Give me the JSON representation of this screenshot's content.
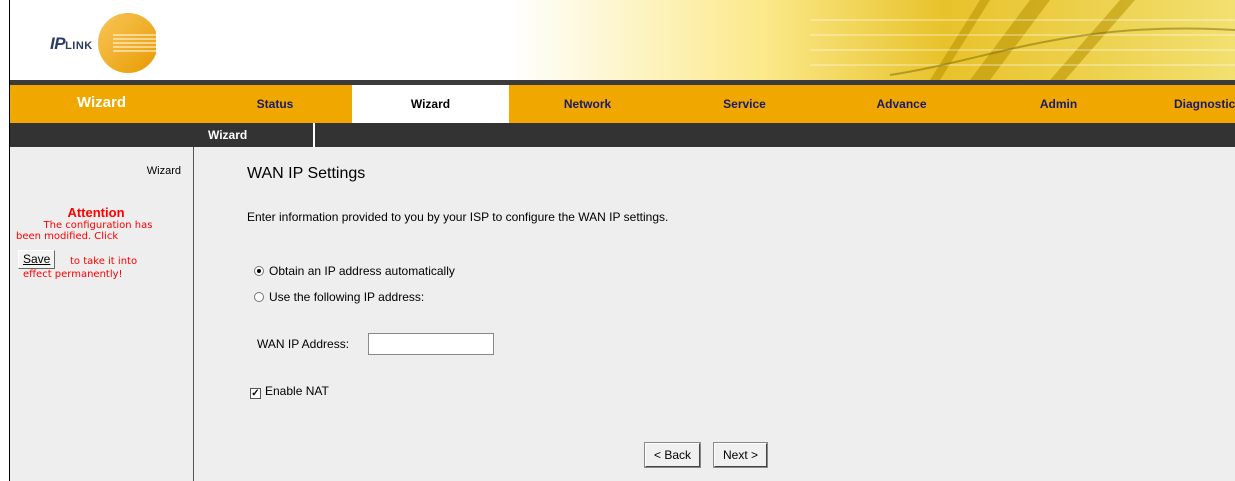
{
  "logo": {
    "brand_main": "IP",
    "brand_small": "LINK"
  },
  "nav": {
    "section_title": "Wizard",
    "items": [
      {
        "label": "Status",
        "active": false
      },
      {
        "label": "Wizard",
        "active": true
      },
      {
        "label": "Network",
        "active": false
      },
      {
        "label": "Service",
        "active": false
      },
      {
        "label": "Advance",
        "active": false
      },
      {
        "label": "Admin",
        "active": false
      },
      {
        "label": "Diagnostic",
        "active": false
      }
    ],
    "subnav_item": "Wizard"
  },
  "sidebar": {
    "heading": "Wizard",
    "attention_title": "Attention",
    "attention_line1": "The configuration has",
    "attention_line2": "been modified. Click",
    "save_label": "Save",
    "save_tail_1": "to take it into",
    "save_tail_2": "effect permanently!"
  },
  "main": {
    "title": "WAN IP Settings",
    "intro": "Enter information provided to you by your ISP to configure the WAN IP settings.",
    "radio_auto": "Obtain an IP address automatically",
    "radio_manual": "Use the following IP address:",
    "wan_ip_label": "WAN IP Address:",
    "wan_ip_value": "",
    "nat_label": "Enable NAT",
    "nat_checked": true,
    "back_label": "< Back",
    "next_label": "Next >"
  },
  "colors": {
    "nav_orange": "#f0a800",
    "subnav_dark": "#333333",
    "content_grey": "#eeeeee",
    "attention_red": "#ff0000"
  }
}
